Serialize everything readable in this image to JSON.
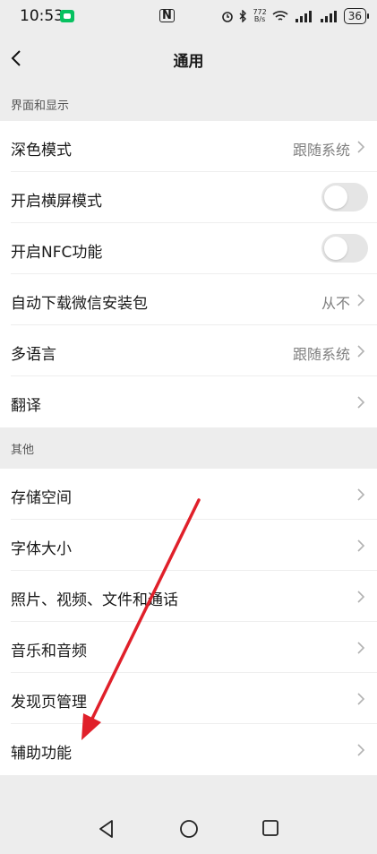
{
  "status_bar": {
    "time": "10:53",
    "nfc": "N",
    "net_speed_top": "772",
    "net_speed_unit": "B/s",
    "battery": "36"
  },
  "header": {
    "title": "通用"
  },
  "sections": [
    {
      "title": "界面和显示",
      "rows": [
        {
          "label": "深色模式",
          "value": "跟随系统",
          "type": "link"
        },
        {
          "label": "开启横屏模式",
          "type": "toggle",
          "on": false
        },
        {
          "label": "开启NFC功能",
          "type": "toggle",
          "on": false
        },
        {
          "label": "自动下载微信安装包",
          "value": "从不",
          "type": "link"
        },
        {
          "label": "多语言",
          "value": "跟随系统",
          "type": "link"
        },
        {
          "label": "翻译",
          "type": "link"
        }
      ]
    },
    {
      "title": "其他",
      "rows": [
        {
          "label": "存储空间",
          "type": "link"
        },
        {
          "label": "字体大小",
          "type": "link"
        },
        {
          "label": "照片、视频、文件和通话",
          "type": "link"
        },
        {
          "label": "音乐和音频",
          "type": "link"
        },
        {
          "label": "发现页管理",
          "type": "link"
        },
        {
          "label": "辅助功能",
          "type": "link"
        }
      ]
    }
  ],
  "colors": {
    "background": "#ededed",
    "annotation_arrow": "#e0202a"
  }
}
